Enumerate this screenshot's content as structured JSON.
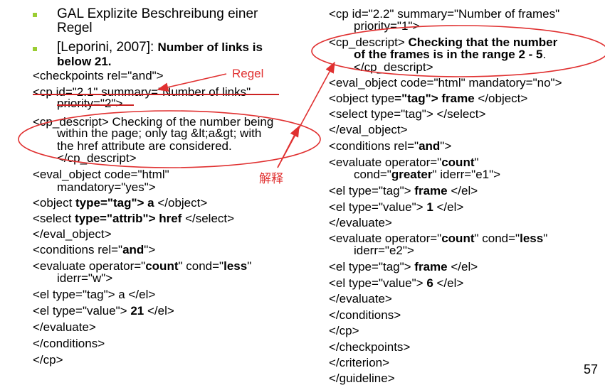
{
  "bullets": [
    {
      "text": "GAL Explizite Beschreibung einer Regel",
      "line1": "GAL Explizite Beschreibung einer",
      "line2": "Regel"
    },
    {
      "prefix": "[Leporini, 2007]: ",
      "bold1": "Number of links is",
      "bold2": "below 21."
    }
  ],
  "left_code": {
    "checkpoints": "<checkpoints rel=\"and\">",
    "cp_open_1": "<cp id=\"2.1\" summary=\"Number of links\"",
    "cp_open_2": "priority=\"2\">",
    "descript_1": "<cp_descript> Checking of the number being",
    "descript_2": "within the page; only tag &lt;a&gt; with",
    "descript_3": "the href attribute are considered.",
    "descript_4": "</cp_descript>",
    "eval_1": "<eval_object code=\"html\"",
    "eval_2": "mandatory=\"yes\">",
    "object_pre": "<object ",
    "object_bold": "type=\"tag\"> a",
    "object_post": " </object>",
    "select_pre": "<select ",
    "select_bold": "type=\"attrib\"> href",
    "select_post": " </select>",
    "eval_close": "</eval_object>",
    "conditions_pre": "<conditions rel=\"",
    "conditions_bold": "and",
    "conditions_post": "\">",
    "evaluate_pre": "<evaluate operator=\"",
    "evaluate_b1": "count",
    "evaluate_mid": "\" cond=\"",
    "evaluate_b2": "less",
    "evaluate_post": "\"",
    "evaluate_2": "iderr=\"w\">",
    "el_tag": "<el type=\"tag\"> a </el>",
    "el_value_pre": "<el type=\"value\"> ",
    "el_value_bold": "21",
    "el_value_post": " </el>",
    "evaluate_close": "</evaluate>",
    "conditions_close": "</conditions>",
    "cp_close": "</cp>"
  },
  "right_code": {
    "cp_open_1": "<cp id=\"2.2\" summary=\"Number of frames\"",
    "cp_open_2": "priority=\"1\">",
    "descript_pre": "<cp_descript> ",
    "descript_bold1": "Checking that the number",
    "descript_bold2": "of the frames is in the range 2 - 5",
    "descript_dot": ".",
    "descript_close": "</cp_descript>",
    "eval_1": "<eval_object code=\"html\" mandatory=\"no\">",
    "object_pre": "<object type",
    "object_bold": "=\"tag\"> frame",
    "object_post": " </object>",
    "select": "<select type=\"tag\"> </select>",
    "eval_close": "</eval_object>",
    "conditions_pre": "<conditions rel=\"",
    "conditions_bold": "and",
    "conditions_post": "\">",
    "ev1_pre": "<evaluate operator=\"",
    "ev1_bold": "count",
    "ev1_post": "\"",
    "ev1_2_pre": "cond=\"",
    "ev1_2_bold": "greater",
    "ev1_2_post": "\" iderr=\"e1\">",
    "el_tag1_pre": "<el type=\"tag\"> ",
    "el_tag1_bold": "frame",
    "el_tag1_post": " </el>",
    "el_val1_pre": "<el type=\"value\"> ",
    "el_val1_bold": "1",
    "el_val1_post": " </el>",
    "ev_close1": "</evaluate>",
    "ev2_pre": "<evaluate operator=\"",
    "ev2_b1": "count",
    "ev2_mid": "\" cond=\"",
    "ev2_b2": "less",
    "ev2_post": "\"",
    "ev2_2": "iderr=\"e2\">",
    "el_tag2_pre": "<el type=\"tag\"> ",
    "el_tag2_bold": "frame",
    "el_tag2_post": " </el>",
    "el_val2_pre": "<el type=\"value\"> ",
    "el_val2_bold": "6",
    "el_val2_post": " </el>",
    "ev_close2": "</evaluate>",
    "conditions_close": "</conditions>",
    "cp_close": "</cp>",
    "checkpoints_close": "</checkpoints>",
    "criterion_close": "</criterion>",
    "guideline_close": "</guideline>"
  },
  "annotations": {
    "regel": "Regel",
    "jieshi": "解释",
    "color": "#e03030"
  },
  "page_number": "57"
}
